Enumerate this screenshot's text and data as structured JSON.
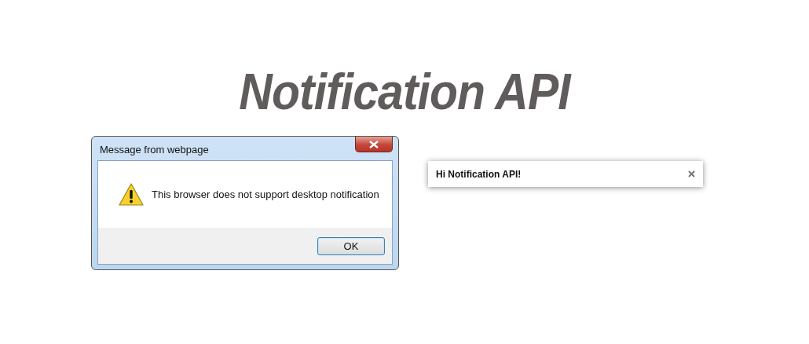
{
  "headline": "Notification API",
  "dialog": {
    "title": "Message from webpage",
    "message": "This browser does not support desktop notification",
    "buttons": [
      "OK"
    ]
  },
  "notification": {
    "text": "Hi Notification API!"
  }
}
